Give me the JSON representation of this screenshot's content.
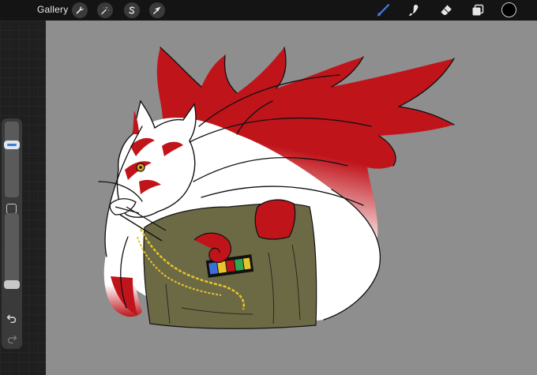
{
  "topbar": {
    "gallery_label": "Gallery",
    "left_tools": [
      "wrench-icon",
      "magic-wand-icon",
      "selection-s-icon",
      "transform-arrow-icon"
    ],
    "right_tools": [
      "brush-icon",
      "smudge-icon",
      "eraser-icon",
      "layers-icon"
    ],
    "active_tool": "brush-icon",
    "active_tool_color": "#3d7be0",
    "current_color": "#000000"
  },
  "sidebar": {
    "brush_size_level": 0.72,
    "brush_opacity_level": 0.0,
    "controls": [
      "brush-size-slider",
      "modifier-button",
      "brush-opacity-slider",
      "undo-icon",
      "redo-icon"
    ]
  },
  "canvas": {
    "background_color": "#8e8e8e",
    "artwork_colors": [
      "#c0141b",
      "#ffffff",
      "#6c6a45",
      "#e6c42a",
      "#111111"
    ]
  }
}
